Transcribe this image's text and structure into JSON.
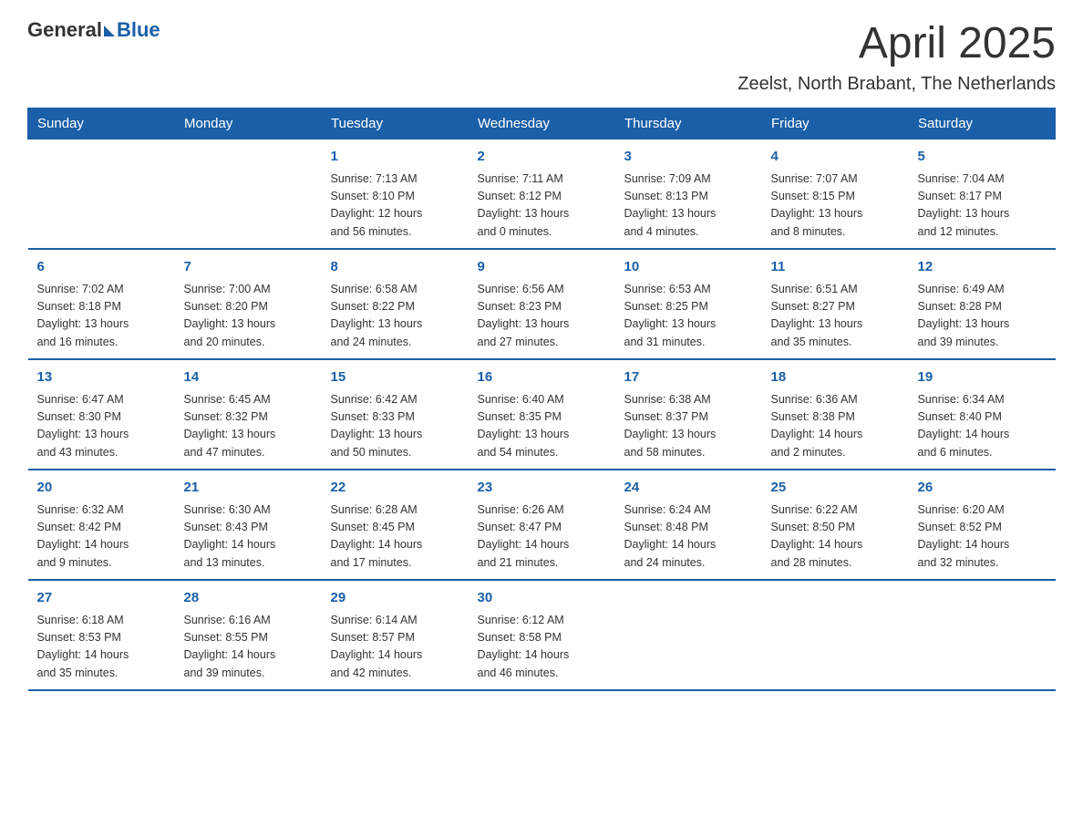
{
  "logo": {
    "text_general": "General",
    "text_blue": "Blue"
  },
  "title": "April 2025",
  "subtitle": "Zeelst, North Brabant, The Netherlands",
  "days_of_week": [
    "Sunday",
    "Monday",
    "Tuesday",
    "Wednesday",
    "Thursday",
    "Friday",
    "Saturday"
  ],
  "weeks": [
    [
      {
        "day": "",
        "info": ""
      },
      {
        "day": "",
        "info": ""
      },
      {
        "day": "1",
        "info": "Sunrise: 7:13 AM\nSunset: 8:10 PM\nDaylight: 12 hours\nand 56 minutes."
      },
      {
        "day": "2",
        "info": "Sunrise: 7:11 AM\nSunset: 8:12 PM\nDaylight: 13 hours\nand 0 minutes."
      },
      {
        "day": "3",
        "info": "Sunrise: 7:09 AM\nSunset: 8:13 PM\nDaylight: 13 hours\nand 4 minutes."
      },
      {
        "day": "4",
        "info": "Sunrise: 7:07 AM\nSunset: 8:15 PM\nDaylight: 13 hours\nand 8 minutes."
      },
      {
        "day": "5",
        "info": "Sunrise: 7:04 AM\nSunset: 8:17 PM\nDaylight: 13 hours\nand 12 minutes."
      }
    ],
    [
      {
        "day": "6",
        "info": "Sunrise: 7:02 AM\nSunset: 8:18 PM\nDaylight: 13 hours\nand 16 minutes."
      },
      {
        "day": "7",
        "info": "Sunrise: 7:00 AM\nSunset: 8:20 PM\nDaylight: 13 hours\nand 20 minutes."
      },
      {
        "day": "8",
        "info": "Sunrise: 6:58 AM\nSunset: 8:22 PM\nDaylight: 13 hours\nand 24 minutes."
      },
      {
        "day": "9",
        "info": "Sunrise: 6:56 AM\nSunset: 8:23 PM\nDaylight: 13 hours\nand 27 minutes."
      },
      {
        "day": "10",
        "info": "Sunrise: 6:53 AM\nSunset: 8:25 PM\nDaylight: 13 hours\nand 31 minutes."
      },
      {
        "day": "11",
        "info": "Sunrise: 6:51 AM\nSunset: 8:27 PM\nDaylight: 13 hours\nand 35 minutes."
      },
      {
        "day": "12",
        "info": "Sunrise: 6:49 AM\nSunset: 8:28 PM\nDaylight: 13 hours\nand 39 minutes."
      }
    ],
    [
      {
        "day": "13",
        "info": "Sunrise: 6:47 AM\nSunset: 8:30 PM\nDaylight: 13 hours\nand 43 minutes."
      },
      {
        "day": "14",
        "info": "Sunrise: 6:45 AM\nSunset: 8:32 PM\nDaylight: 13 hours\nand 47 minutes."
      },
      {
        "day": "15",
        "info": "Sunrise: 6:42 AM\nSunset: 8:33 PM\nDaylight: 13 hours\nand 50 minutes."
      },
      {
        "day": "16",
        "info": "Sunrise: 6:40 AM\nSunset: 8:35 PM\nDaylight: 13 hours\nand 54 minutes."
      },
      {
        "day": "17",
        "info": "Sunrise: 6:38 AM\nSunset: 8:37 PM\nDaylight: 13 hours\nand 58 minutes."
      },
      {
        "day": "18",
        "info": "Sunrise: 6:36 AM\nSunset: 8:38 PM\nDaylight: 14 hours\nand 2 minutes."
      },
      {
        "day": "19",
        "info": "Sunrise: 6:34 AM\nSunset: 8:40 PM\nDaylight: 14 hours\nand 6 minutes."
      }
    ],
    [
      {
        "day": "20",
        "info": "Sunrise: 6:32 AM\nSunset: 8:42 PM\nDaylight: 14 hours\nand 9 minutes."
      },
      {
        "day": "21",
        "info": "Sunrise: 6:30 AM\nSunset: 8:43 PM\nDaylight: 14 hours\nand 13 minutes."
      },
      {
        "day": "22",
        "info": "Sunrise: 6:28 AM\nSunset: 8:45 PM\nDaylight: 14 hours\nand 17 minutes."
      },
      {
        "day": "23",
        "info": "Sunrise: 6:26 AM\nSunset: 8:47 PM\nDaylight: 14 hours\nand 21 minutes."
      },
      {
        "day": "24",
        "info": "Sunrise: 6:24 AM\nSunset: 8:48 PM\nDaylight: 14 hours\nand 24 minutes."
      },
      {
        "day": "25",
        "info": "Sunrise: 6:22 AM\nSunset: 8:50 PM\nDaylight: 14 hours\nand 28 minutes."
      },
      {
        "day": "26",
        "info": "Sunrise: 6:20 AM\nSunset: 8:52 PM\nDaylight: 14 hours\nand 32 minutes."
      }
    ],
    [
      {
        "day": "27",
        "info": "Sunrise: 6:18 AM\nSunset: 8:53 PM\nDaylight: 14 hours\nand 35 minutes."
      },
      {
        "day": "28",
        "info": "Sunrise: 6:16 AM\nSunset: 8:55 PM\nDaylight: 14 hours\nand 39 minutes."
      },
      {
        "day": "29",
        "info": "Sunrise: 6:14 AM\nSunset: 8:57 PM\nDaylight: 14 hours\nand 42 minutes."
      },
      {
        "day": "30",
        "info": "Sunrise: 6:12 AM\nSunset: 8:58 PM\nDaylight: 14 hours\nand 46 minutes."
      },
      {
        "day": "",
        "info": ""
      },
      {
        "day": "",
        "info": ""
      },
      {
        "day": "",
        "info": ""
      }
    ]
  ]
}
